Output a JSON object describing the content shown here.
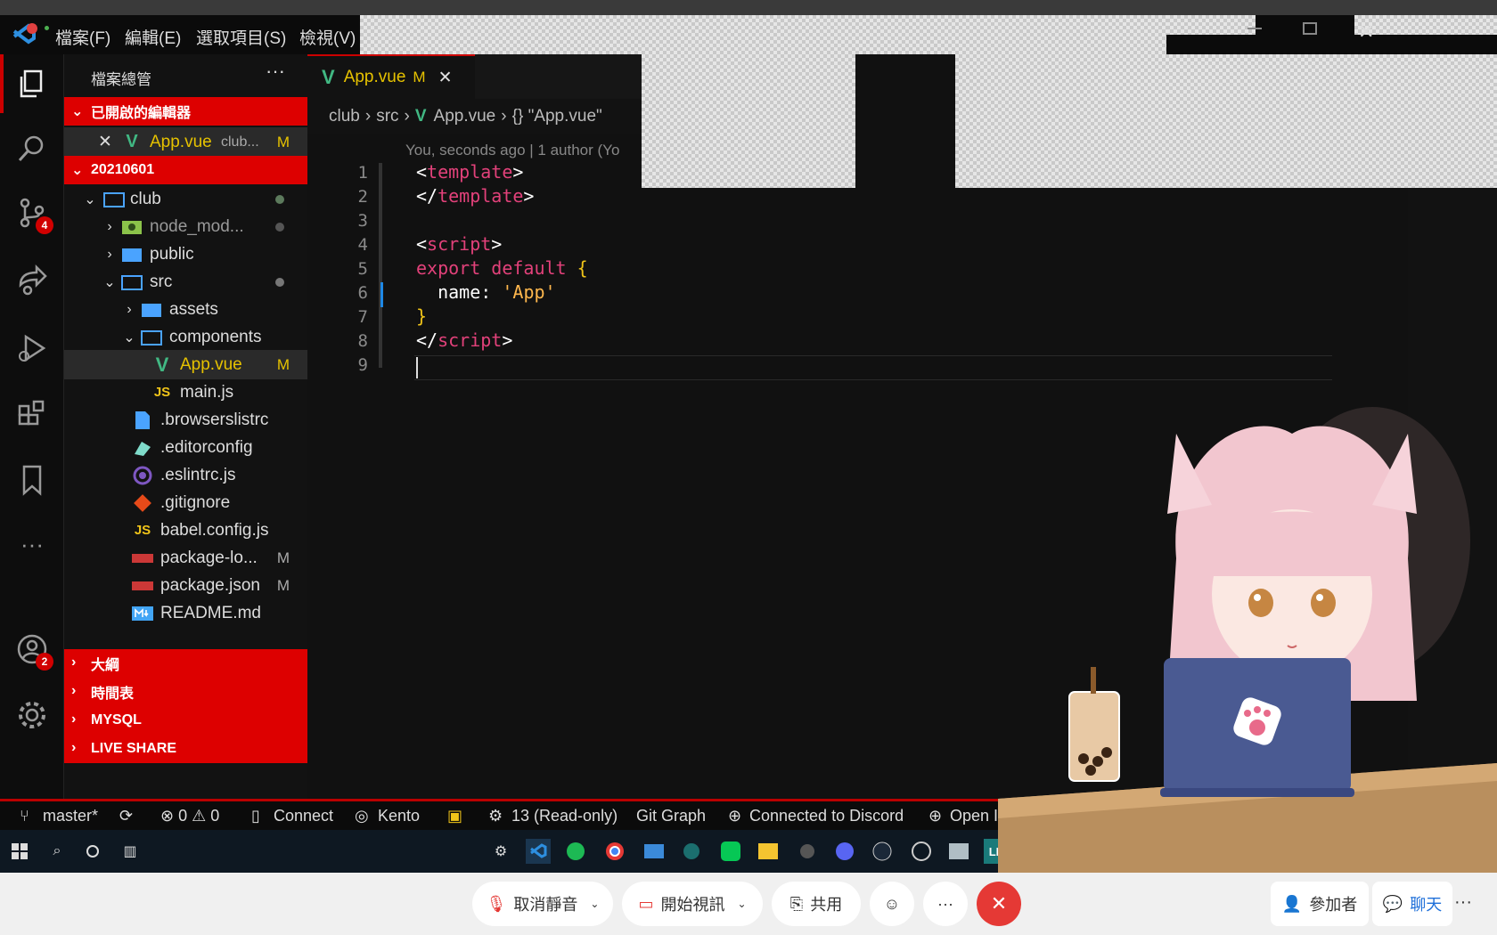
{
  "menu": [
    "檔案(F)",
    "編輯(E)",
    "選取項目(S)",
    "檢視(V)"
  ],
  "explorer": {
    "title": "檔案總管",
    "more": "···",
    "open_editors_label": "已開啟的編輯器",
    "open_editor": {
      "name": "App.vue",
      "path": "club...",
      "status": "M"
    },
    "workspace_label": "20210601",
    "tree": [
      {
        "name": "club",
        "twisty": "⌄",
        "icon": "folder-open",
        "dot": true
      },
      {
        "name": "node_mod...",
        "twisty": "›",
        "icon": "folder-node",
        "dot": true
      },
      {
        "name": "public",
        "twisty": "›",
        "icon": "folder",
        "dot": false
      },
      {
        "name": "src",
        "twisty": "⌄",
        "icon": "folder-open",
        "dot": true
      },
      {
        "name": "assets",
        "twisty": "›",
        "icon": "folder",
        "dot": false
      },
      {
        "name": "components",
        "twisty": "⌄",
        "icon": "folder-open",
        "dot": false
      },
      {
        "name": "App.vue",
        "twisty": "",
        "icon": "vue",
        "status": "M"
      },
      {
        "name": "main.js",
        "twisty": "",
        "icon": "js"
      },
      {
        "name": ".browserslistrc",
        "twisty": "",
        "icon": "file"
      },
      {
        "name": ".editorconfig",
        "twisty": "",
        "icon": "editorconfig"
      },
      {
        "name": ".eslintrc.js",
        "twisty": "",
        "icon": "eslint"
      },
      {
        "name": ".gitignore",
        "twisty": "",
        "icon": "git"
      },
      {
        "name": "babel.config.js",
        "twisty": "",
        "icon": "js"
      },
      {
        "name": "package-lo...",
        "twisty": "",
        "icon": "npm",
        "status": "M"
      },
      {
        "name": "package.json",
        "twisty": "",
        "icon": "npm",
        "status": "M"
      },
      {
        "name": "README.md",
        "twisty": "",
        "icon": "markdown"
      }
    ],
    "sections": [
      "大綱",
      "時間表",
      "MYSQL",
      "LIVE SHARE"
    ]
  },
  "activity": {
    "scm_badge": "4",
    "accounts_badge": "2"
  },
  "tab": {
    "name": "App.vue",
    "status": "M",
    "close": "✕"
  },
  "breadcrumb": [
    "club",
    "src",
    "App.vue",
    "{} \"App.vue\""
  ],
  "blame": "You, seconds ago | 1 author (Yo",
  "code_lines": [
    {
      "n": "1",
      "html": "<span class='tg'>&lt;</span><span class='kw'>template</span><span class='tg'>&gt;</span>"
    },
    {
      "n": "2",
      "html": "<span class='tg'>&lt;/</span><span class='kw'>template</span><span class='tg'>&gt;</span>"
    },
    {
      "n": "3",
      "html": ""
    },
    {
      "n": "4",
      "html": "<span class='tg'>&lt;</span><span class='kw'>script</span><span class='tg'>&gt;</span>"
    },
    {
      "n": "5",
      "html": "<span class='kw'>export default</span> <span class='br'>{</span>"
    },
    {
      "n": "6",
      "html": "  <span class='tg'>name:</span> <span class='str'>'App'</span>"
    },
    {
      "n": "7",
      "html": "<span class='br'>}</span>"
    },
    {
      "n": "8",
      "html": "<span class='tg'>&lt;/</span><span class='kw'>script</span><span class='tg'>&gt;</span>"
    },
    {
      "n": "9",
      "html": ""
    }
  ],
  "statusbar": {
    "branch": "master*",
    "problems": "⊗ 0 ⚠ 0",
    "connect": "Connect",
    "user": "Kento",
    "tasks": "13 (Read-only)",
    "git_graph": "Git Graph",
    "discord": "Connected to Discord",
    "open_browser": "Open In Brows"
  },
  "meeting": {
    "unmute": "取消靜音",
    "video": "開始視訊",
    "share": "共用",
    "participants": "參加者",
    "chat": "聊天",
    "more": "···"
  },
  "colors": {
    "accent_red": "#dd0000",
    "vue_green": "#41b883",
    "js_yellow": "#f0c419"
  }
}
